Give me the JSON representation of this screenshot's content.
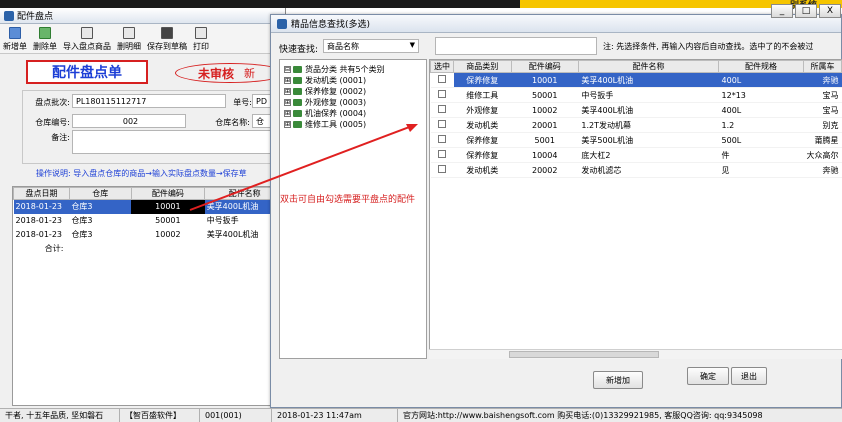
{
  "topbar": {
    "right_text": "别系统"
  },
  "main_window": {
    "title": "配件盘点",
    "toolbar": [
      {
        "label": "新增单",
        "icon": "new-doc-icon"
      },
      {
        "label": "删除单",
        "icon": "delete-doc-icon"
      },
      {
        "label": "导入盘点商品",
        "icon": "import-icon"
      },
      {
        "label": "删明细",
        "icon": "delete-detail-icon"
      },
      {
        "label": "保存到草稿",
        "icon": "save-icon"
      },
      {
        "label": "打印",
        "icon": "print-icon"
      }
    ],
    "form_title": "配件盘点单",
    "status": "未审核",
    "status_new": "新",
    "fields": {
      "batch_label": "盘点批次:",
      "batch_value": "PL180115112717",
      "doc_no_label": "单号:",
      "doc_no_value": "PD",
      "warehouse_no_label": "仓库编号:",
      "warehouse_no_value": "002",
      "warehouse_name_label": "仓库名称:",
      "warehouse_name_value": "仓",
      "remark_label": "备注:"
    },
    "instruction": "操作说明: 导入盘点仓库的商品→输入实际盘点数量→保存草",
    "grid": {
      "headers": [
        "盘点日期",
        "仓库",
        "配件编码",
        "配件名称"
      ],
      "rows": [
        [
          "2018-01-23",
          "仓库3",
          "10001",
          "美孚400L机油"
        ],
        [
          "2018-01-23",
          "仓库3",
          "50001",
          "中号扳手"
        ],
        [
          "2018-01-23",
          "仓库3",
          "10002",
          "美孚400L机油"
        ]
      ],
      "total_label": "合计:"
    }
  },
  "dialog": {
    "title": "精品信息查找(多选)",
    "quick_search_label": "快速查找:",
    "quick_search_value": "商品名称",
    "search_value": "",
    "hint": "注: 先选择条件, 再输入内容后自动查找。选中了的不会被过",
    "tree": [
      {
        "label": "货品分类  共有5个类别",
        "expander": "⊟"
      },
      {
        "label": "发动机类 (0001)",
        "expander": "⊞"
      },
      {
        "label": "保养修复 (0002)",
        "expander": "⊞"
      },
      {
        "label": "外观修复 (0003)",
        "expander": "⊞"
      },
      {
        "label": "机油保养 (0004)",
        "expander": "⊞"
      },
      {
        "label": "维修工具 (0005)",
        "expander": "⊞"
      }
    ],
    "grid": {
      "headers": [
        "选中",
        "商品类别",
        "配件编码",
        "配件名称",
        "配件规格",
        "所属车"
      ],
      "rows": [
        [
          "",
          "保养修复",
          "10001",
          "美孚400L机油",
          "400L",
          "奔驰"
        ],
        [
          "",
          "维修工具",
          "50001",
          "中号扳手",
          "12*13",
          "宝马"
        ],
        [
          "",
          "外观修复",
          "10002",
          "美孚400L机油",
          "400L",
          "宝马"
        ],
        [
          "",
          "发动机类",
          "20001",
          "1.2T发动机幕",
          "1.2",
          "别克"
        ],
        [
          "",
          "保养修复",
          "5001",
          "美孚500L机油",
          "500L",
          "莆腾星"
        ],
        [
          "",
          "保养修复",
          "10004",
          "底大杠2",
          "件",
          "大众高尔"
        ],
        [
          "",
          "发动机类",
          "20002",
          "发动机滤芯",
          "见",
          "奔驰"
        ]
      ]
    },
    "buttons": {
      "add": "新增加",
      "ok": "确定",
      "exit": "退出"
    },
    "window_buttons": [
      "_",
      "□",
      "X"
    ]
  },
  "annotation": "双击可自由勾选需要平盘点的配件",
  "statusbar": [
    "干者, 十五年品质, 坚如磐石",
    "【智百盛软件】",
    "001(001)",
    "2018-01-23 11:47am",
    "官方网站:http://www.baishengsoft.com 购买电话:(0)13329921985, 客服QQ咨询: qq:9345098"
  ]
}
